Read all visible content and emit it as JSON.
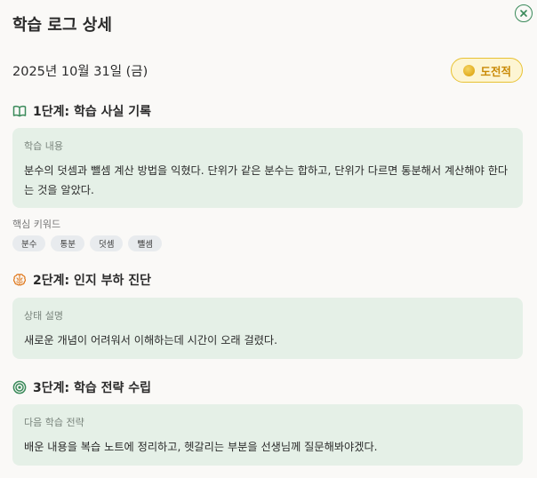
{
  "title": "학습 로그 상세",
  "close_icon": "close-circle-icon",
  "date": "2025년 10월 31일 (금)",
  "badge": {
    "label": "도전적",
    "icon": "coin-dot-icon",
    "color": "#e8c233"
  },
  "step1": {
    "icon": "open-book-icon",
    "title": "1단계: 학습 사실 기록",
    "card_label": "학습 내용",
    "card_text": "분수의 덧셈과 뺄셈 계산 방법을 익혔다. 단위가 같은 분수는 합하고, 단위가 다르면 통분해서 계산해야 한다는 것을 알았다."
  },
  "keywords": {
    "label": "핵심 키워드",
    "items": [
      "분수",
      "통분",
      "덧셈",
      "뺄셈"
    ]
  },
  "step2": {
    "icon": "brain-icon",
    "title": "2단계: 인지 부하 진단",
    "card_label": "상태 설명",
    "card_text": "새로운 개념이 어려워서 이해하는데 시간이 오래 걸렸다."
  },
  "step3": {
    "icon": "target-icon",
    "title": "3단계: 학습 전략 수립",
    "card_label": "다음 학습 전략",
    "card_text": "배운 내용을 복습 노트에 정리하고, 헷갈리는 부분을 선생님께 질문해봐야겠다."
  },
  "colors": {
    "accent_green": "#3a8a5a",
    "brain_orange": "#e07a1f",
    "card_bg": "#e5f0e7"
  }
}
